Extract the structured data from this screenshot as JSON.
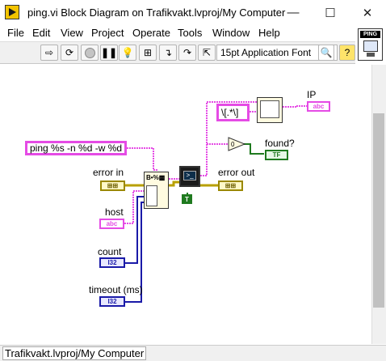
{
  "window": {
    "title": "ping.vi Block Diagram on Trafikvakt.lvproj/My Computer",
    "minimize_glyph": "—",
    "maximize_glyph": "☐",
    "close_glyph": "✕"
  },
  "menu": [
    "File",
    "Edit",
    "View",
    "Project",
    "Operate",
    "Tools",
    "Window",
    "Help"
  ],
  "toolbar": {
    "font_select": "15pt Application Font",
    "icons": [
      "run-arrow-icon",
      "run-continuously-icon",
      "abort-icon",
      "pause-icon",
      "highlight-execution-icon",
      "retain-wire-values-icon",
      "step-into-icon",
      "step-over-icon",
      "step-out-icon",
      "search-icon",
      "help-icon"
    ]
  },
  "connector_pane": {
    "label": "PING"
  },
  "diagram": {
    "format_string": "ping %s -n %d -w %d",
    "regex": "\\[.*\\]",
    "labels": {
      "error_in": "error in",
      "host": "host",
      "count": "count",
      "timeout": "timeout (ms)",
      "error_out": "error out",
      "ip": "IP",
      "found": "found?"
    },
    "terminals": {
      "host_type": "abc",
      "count_type": "I32",
      "timeout_type": "I32",
      "ip_type": "abc",
      "found_type": "TF",
      "bool_const": "T"
    },
    "colors": {
      "string_wire": "#e54be5",
      "int_wire": "#1a1aa8",
      "error_wire": "#b8a000",
      "bool_wire": "#1f7a1f"
    }
  },
  "status": {
    "text": "Trafikvakt.lvproj/My Computer"
  }
}
